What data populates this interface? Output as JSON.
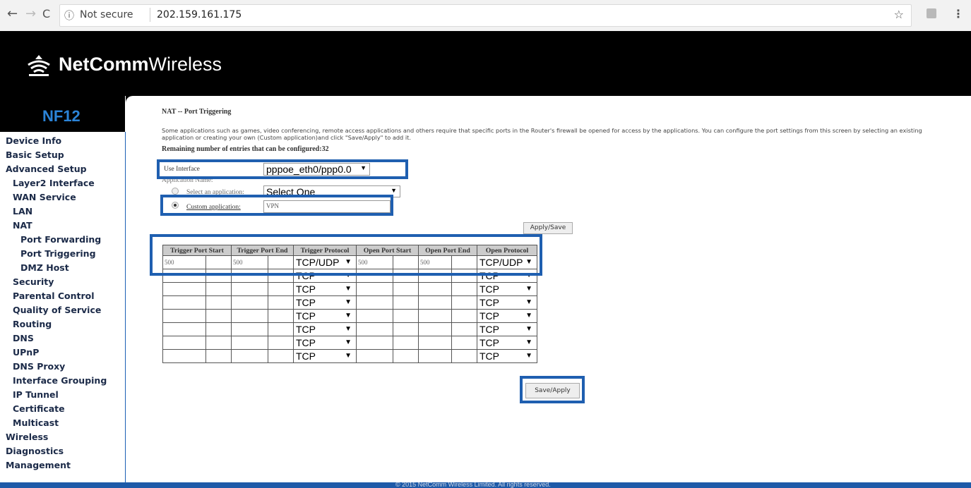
{
  "browser": {
    "security_label": "Not secure",
    "url": "202.159.161.175",
    "back_glyph": "←",
    "forward_glyph": "→",
    "reload_glyph": "C",
    "info_glyph": "ⓘ",
    "star_glyph": "☆",
    "menu_glyph": "⋮"
  },
  "brand": {
    "name_bold": "NetComm",
    "name_regular": "Wireless",
    "model": "NF12",
    "accent": "#2b84d8"
  },
  "menu": {
    "items": [
      "Device Info",
      "Basic Setup",
      "Advanced Setup",
      "Layer2 Interface",
      "WAN Service",
      "LAN",
      "NAT",
      "Port Forwarding",
      "Port Triggering",
      "DMZ Host",
      "Security",
      "Parental Control",
      "Quality of Service",
      "Routing",
      "DNS",
      "UPnP",
      "DNS Proxy",
      "Interface Grouping",
      "IP Tunnel",
      "Certificate",
      "Multicast",
      "Wireless",
      "Diagnostics",
      "Management"
    ]
  },
  "page": {
    "title": "NAT -- Port Triggering",
    "description": "Some applications such as games, video conferencing, remote access applications and others require that specific ports in the Router's firewall be opened for access by the applications. You can configure the port settings from this screen by selecting an existing application or creating your own (Custom application)and click \"Save/Apply\" to add it.",
    "remaining": "Remaining number of entries that can be configured:32"
  },
  "form": {
    "use_interface_label": "Use Interface",
    "use_interface_value": "pppoe_eth0/ppp0.0",
    "application_name_label": "Application Name:",
    "select_app_label": "Select an application:",
    "select_app_value": "Select One",
    "custom_app_label": "Custom application:",
    "custom_app_value": "VPN",
    "custom_selected": true,
    "apply_save_label": "Apply/Save",
    "save_apply_label": "Save/Apply"
  },
  "table": {
    "headers": [
      "Trigger Port Start",
      "Trigger Port End",
      "Trigger Protocol",
      "Open Port Start",
      "Open Port End",
      "Open Protocol"
    ],
    "rows": [
      {
        "trigger_start": "500",
        "trigger_end": "500",
        "trigger_protocol": "TCP/UDP",
        "open_start": "500",
        "open_end": "500",
        "open_protocol": "TCP/UDP"
      },
      {
        "trigger_start": "",
        "trigger_end": "",
        "trigger_protocol": "TCP",
        "open_start": "",
        "open_end": "",
        "open_protocol": "TCP"
      },
      {
        "trigger_start": "",
        "trigger_end": "",
        "trigger_protocol": "TCP",
        "open_start": "",
        "open_end": "",
        "open_protocol": "TCP"
      },
      {
        "trigger_start": "",
        "trigger_end": "",
        "trigger_protocol": "TCP",
        "open_start": "",
        "open_end": "",
        "open_protocol": "TCP"
      },
      {
        "trigger_start": "",
        "trigger_end": "",
        "trigger_protocol": "TCP",
        "open_start": "",
        "open_end": "",
        "open_protocol": "TCP"
      },
      {
        "trigger_start": "",
        "trigger_end": "",
        "trigger_protocol": "TCP",
        "open_start": "",
        "open_end": "",
        "open_protocol": "TCP"
      },
      {
        "trigger_start": "",
        "trigger_end": "",
        "trigger_protocol": "TCP",
        "open_start": "",
        "open_end": "",
        "open_protocol": "TCP"
      },
      {
        "trigger_start": "",
        "trigger_end": "",
        "trigger_protocol": "TCP",
        "open_start": "",
        "open_end": "",
        "open_protocol": "TCP"
      }
    ]
  },
  "footer": {
    "copyright": "© 2015 NetComm Wireless Limited. All rights reserved."
  },
  "colors": {
    "highlight": "#1f5fb0",
    "menu_text": "#1b2a48",
    "footer": "#1e5aa8"
  }
}
